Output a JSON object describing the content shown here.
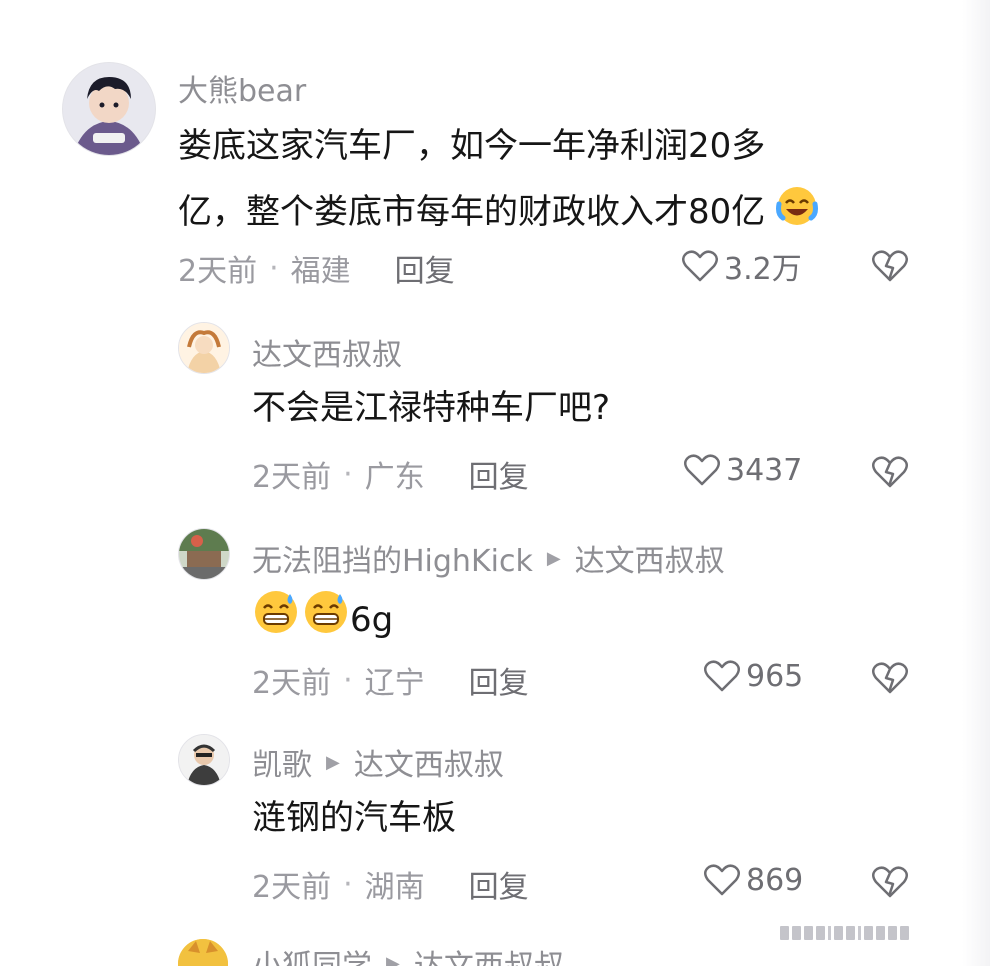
{
  "comments": [
    {
      "username": "大熊bear",
      "text_line1": "娄底这家汽车厂，如今一年净利润20多",
      "text_line2": "亿，整个娄底市每年的财政收入才80亿",
      "emoji": "laughing-crying-emoji",
      "time": "2天前",
      "location": "福建",
      "reply_label": "回复",
      "likes": "3.2万"
    },
    {
      "username": "达文西叔叔",
      "text": "不会是江禄特种车厂吧?",
      "time": "2天前",
      "location": "广东",
      "reply_label": "回复",
      "likes": "3437"
    },
    {
      "username": "无法阻挡的HighKick",
      "reply_to": "达文西叔叔",
      "text": "6g",
      "emoji": "sweat-grin-emoji",
      "time": "2天前",
      "location": "辽宁",
      "reply_label": "回复",
      "likes": "965"
    },
    {
      "username": "凯歌",
      "reply_to": "达文西叔叔",
      "text": "涟钢的汽车板",
      "time": "2天前",
      "location": "湖南",
      "reply_label": "回复",
      "likes": "869"
    },
    {
      "username": "小狐同学",
      "reply_to": "达文西叔叔"
    }
  ],
  "icons": {
    "like": "heart-outline-icon",
    "dislike": "broken-heart-icon",
    "reply_arrow": "triangle-right-icon"
  },
  "colors": {
    "text": "#161616",
    "meta": "#9a9aa0",
    "name": "#8e8e93"
  }
}
